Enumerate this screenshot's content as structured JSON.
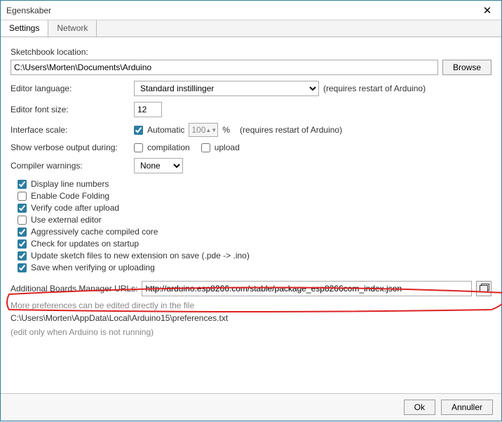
{
  "window": {
    "title": "Egenskaber"
  },
  "tabs": {
    "settings": "Settings",
    "network": "Network"
  },
  "labels": {
    "sketchbook": "Sketchbook location:",
    "editor_lang": "Editor language:",
    "editor_fs": "Editor font size:",
    "iface_scale": "Interface scale:",
    "verbose": "Show verbose output during:",
    "compiler_warn": "Compiler warnings:",
    "boards": "Additional Boards Manager URLs:"
  },
  "values": {
    "sketchbook_path": "C:\\Users\\Morten\\Documents\\Arduino",
    "language_sel": "Standard instillinger",
    "font_size": "12",
    "automatic": "Automatic",
    "scale_pct": "100",
    "percent": "%",
    "warnings_sel": "None",
    "boards_url": "http://arduino.esp8266.com/stable/package_esp8266com_index.json"
  },
  "buttons": {
    "browse": "Browse",
    "ok": "Ok",
    "cancel": "Annuller"
  },
  "notes": {
    "restart1": "(requires restart of Arduino)",
    "restart2": "(requires restart of Arduino)",
    "more_prefs": "More preferences can be edited directly in the file",
    "prefs_path": "C:\\Users\\Morten\\AppData\\Local\\Arduino15\\preferences.txt",
    "edit_only": "(edit only when Arduino is not running)"
  },
  "checks": {
    "compilation": "compilation",
    "upload": "upload",
    "display_line": "Display line numbers",
    "code_folding": "Enable Code Folding",
    "verify_upload": "Verify code after upload",
    "external_editor": "Use external editor",
    "agg_cache": "Aggressively cache compiled core",
    "check_updates": "Check for updates on startup",
    "update_ext": "Update sketch files to new extension on save (.pde -> .ino)",
    "save_verify": "Save when verifying or uploading"
  }
}
